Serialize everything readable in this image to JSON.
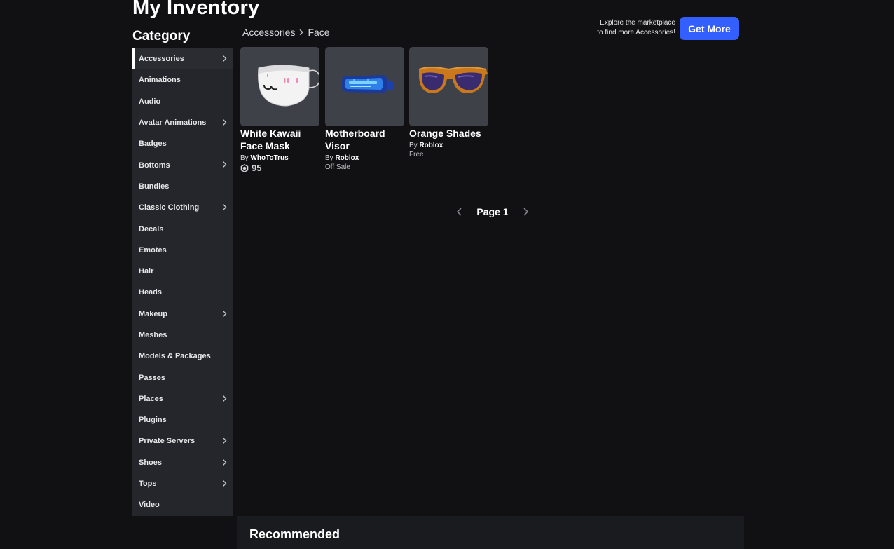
{
  "page": {
    "title": "My Inventory"
  },
  "sidebar": {
    "heading": "Category",
    "items": [
      {
        "label": "Accessories",
        "has_submenu": true,
        "active": true
      },
      {
        "label": "Animations",
        "has_submenu": false
      },
      {
        "label": "Audio",
        "has_submenu": false
      },
      {
        "label": "Avatar Animations",
        "has_submenu": true
      },
      {
        "label": "Badges",
        "has_submenu": false
      },
      {
        "label": "Bottoms",
        "has_submenu": true
      },
      {
        "label": "Bundles",
        "has_submenu": false
      },
      {
        "label": "Classic Clothing",
        "has_submenu": true
      },
      {
        "label": "Decals",
        "has_submenu": false
      },
      {
        "label": "Emotes",
        "has_submenu": false
      },
      {
        "label": "Hair",
        "has_submenu": false
      },
      {
        "label": "Heads",
        "has_submenu": false
      },
      {
        "label": "Makeup",
        "has_submenu": true
      },
      {
        "label": "Meshes",
        "has_submenu": false
      },
      {
        "label": "Models & Packages",
        "has_submenu": false
      },
      {
        "label": "Passes",
        "has_submenu": false
      },
      {
        "label": "Places",
        "has_submenu": true
      },
      {
        "label": "Plugins",
        "has_submenu": false
      },
      {
        "label": "Private Servers",
        "has_submenu": true
      },
      {
        "label": "Shoes",
        "has_submenu": true
      },
      {
        "label": "Tops",
        "has_submenu": true
      },
      {
        "label": "Video",
        "has_submenu": false
      }
    ]
  },
  "breadcrumb": {
    "parent": "Accessories",
    "current": "Face"
  },
  "promo": {
    "line1": "Explore the marketplace",
    "line2": "to find more Accessories!",
    "button_label": "Get More"
  },
  "items": [
    {
      "name": "White Kawaii Face Mask",
      "by": "By",
      "creator": "WhoToTrus",
      "price": "95",
      "price_icon": "robux-icon"
    },
    {
      "name": "Motherboard Visor",
      "by": "By",
      "creator": "Roblox",
      "status": "Off Sale"
    },
    {
      "name": "Orange Shades",
      "by": "By",
      "creator": "Roblox",
      "status": "Free"
    }
  ],
  "pager": {
    "label": "Page 1",
    "prev_icon": "chevron-left-icon",
    "next_icon": "chevron-right-icon"
  },
  "recommended": {
    "title": "Recommended"
  },
  "colors": {
    "accent": "#335fff",
    "background": "#111114",
    "sidebar": "#24262b",
    "card": "#3e4148"
  }
}
